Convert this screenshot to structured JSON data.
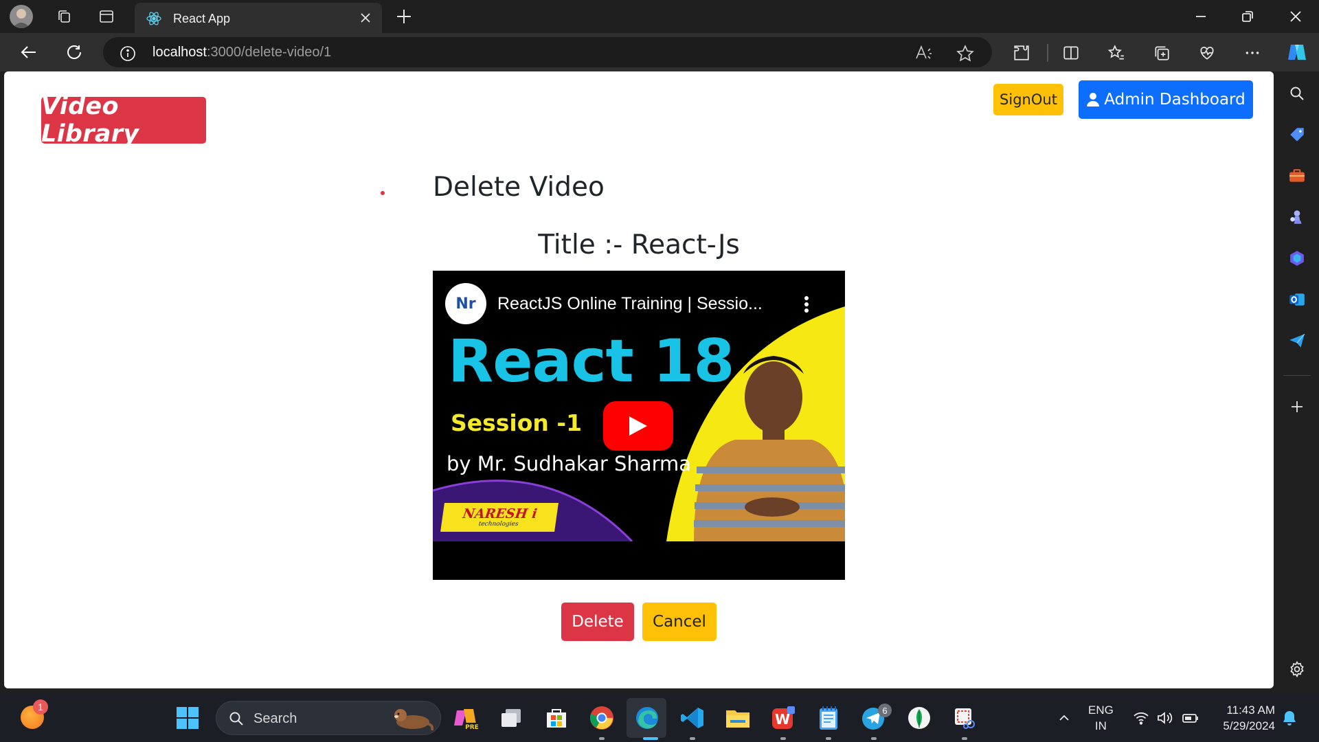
{
  "browser": {
    "tab_title": "React App",
    "url_host": "localhost",
    "url_path": ":3000/delete-video/1"
  },
  "app": {
    "brand": "Video Library",
    "signout_label": "SignOut",
    "admin_dashboard_label": "Admin Dashboard",
    "page_heading": "Delete Video",
    "video_title_line": "Title :- React-Js",
    "delete_label": "Delete",
    "cancel_label": "Cancel",
    "colors": {
      "danger": "#dc3545",
      "warning": "#ffc107",
      "primary": "#0d6efd"
    }
  },
  "video_embed": {
    "channel_avatar_text": "Nr",
    "title": "ReactJS Online Training | Sessio...",
    "thumbnail_heading": "React 18",
    "thumbnail_session": "Session -1",
    "thumbnail_author": "by Mr. Sudhakar Sharma",
    "thumbnail_logo": "NARESH i",
    "thumbnail_logo_sub": "technologies"
  },
  "taskbar": {
    "search_placeholder": "Search",
    "weather_badge": "1",
    "telegram_badge": "6",
    "lang_line1": "ENG",
    "lang_line2": "IN",
    "time": "11:43 AM",
    "date": "5/29/2024"
  }
}
